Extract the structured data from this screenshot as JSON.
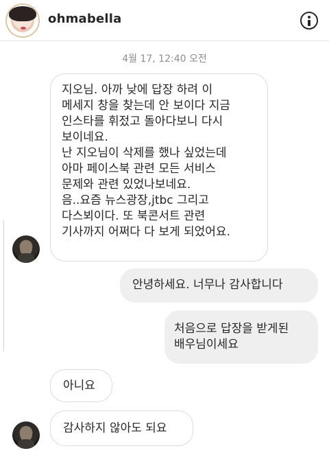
{
  "header": {
    "username": "ohmabella",
    "avatar_icon": "profile-avatar",
    "info_icon": "info-circle-icon"
  },
  "timestamp": "4월 17, 12:40 오전",
  "messages": [
    {
      "direction": "incoming",
      "lines": [
        "지오님. 아까 낮에 답장 하려 이",
        "메세지 창을 찾는데 안 보이다 지금",
        "인스타를 휘젔고 돌아다보니 다시",
        "보이네요.",
        "난 지오님이 삭제를 했나 싶었는데",
        "아마 페이스북 관련 모든 서비스",
        "문제와 관련 있었나보네요.",
        "음..요즘 뉴스광장,jtbc 그리고",
        "다스뵈이다. 또 북콘서트 관련",
        "기사까지 어쩌다 다 보게 되었어요."
      ]
    },
    {
      "direction": "outgoing",
      "lines": [
        "안녕하세요. 너무나 감사합니다"
      ]
    },
    {
      "direction": "outgoing",
      "lines": [
        "처음으로 답장을 받게된",
        "배우님이세요"
      ]
    },
    {
      "direction": "incoming",
      "lines": [
        "아니요"
      ]
    },
    {
      "direction": "incoming",
      "lines": [
        "감사하지 않아도 되요"
      ]
    }
  ]
}
